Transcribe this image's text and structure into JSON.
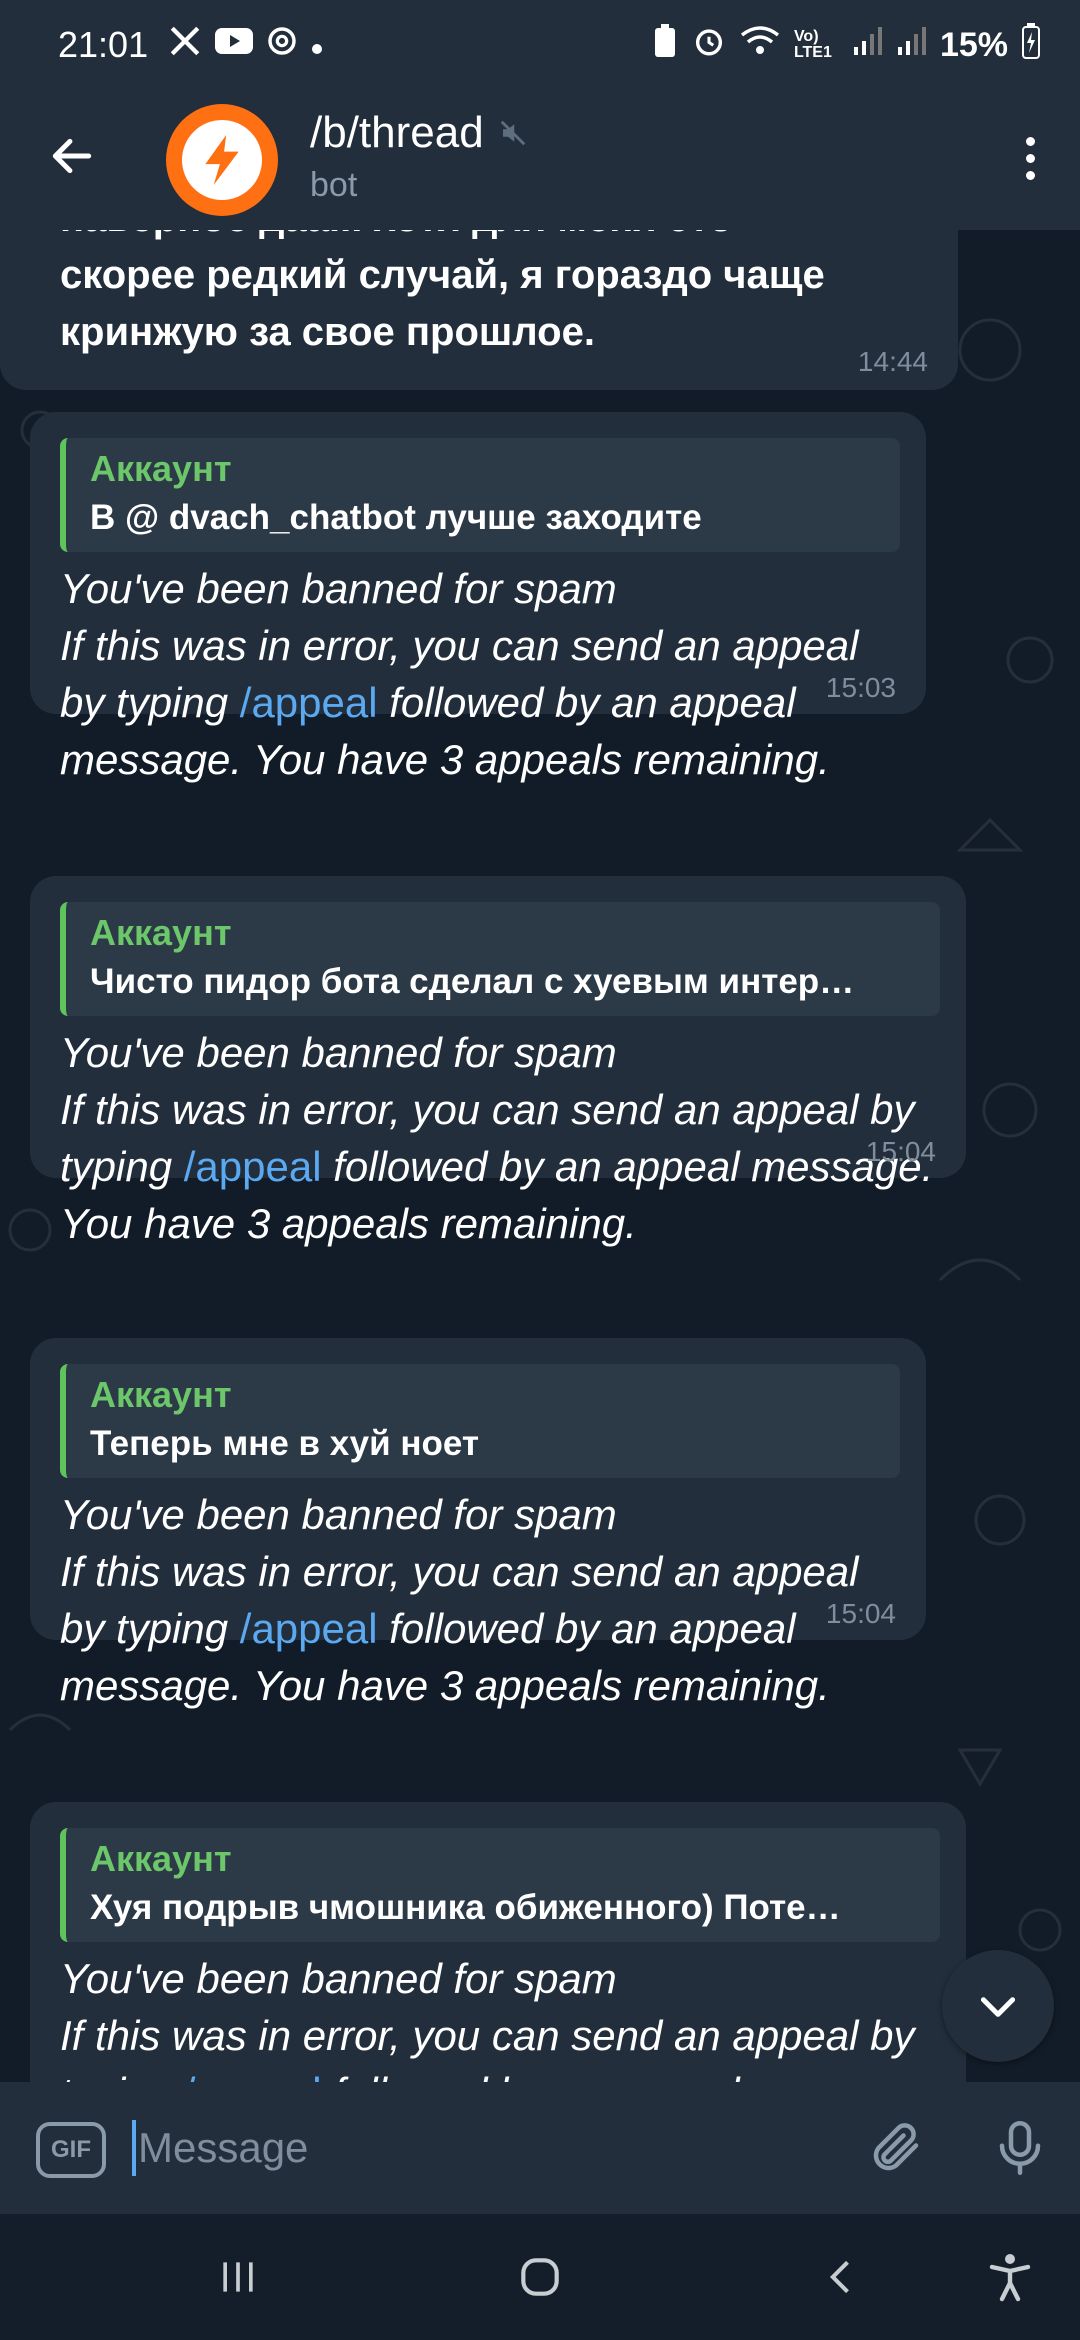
{
  "status_bar": {
    "time": "21:01",
    "left_icons": [
      "x-icon",
      "youtube-icon",
      "threads-icon",
      "dot-icon"
    ],
    "right_icons": [
      "battery-saver-icon",
      "alarm-icon",
      "wifi-icon",
      "volte-icon",
      "signal-icon",
      "signal-icon"
    ],
    "volte_label": "Vo) LTE1",
    "battery": "15%"
  },
  "header": {
    "title": "/b/thread",
    "subtitle": "bot",
    "muted": true,
    "avatar_color": "#ff7012"
  },
  "messages": [
    {
      "type": "text",
      "text": "наверное даа... хотя для меня это скорее редкий случай, я гораздо чаще кринжую за свое прошлое.",
      "time": "14:44"
    },
    {
      "type": "ban",
      "reply_author": "Аккаунт",
      "reply_text": "В @ dvach_chatbot лучше заходите",
      "line1": "You've been banned for spam",
      "line2": "If this was in error, you can send an appeal by typing",
      "command": "/appeal",
      "line3": "followed by an appeal message. You have 3 appeals remaining.",
      "time": "15:03"
    },
    {
      "type": "ban",
      "reply_author": "Аккаунт",
      "reply_text": "Чисто пидор бота сделал с хуевым интер…",
      "line1": "You've been banned for spam",
      "line2": "If this was in error, you can send an appeal by typing",
      "command": "/appeal",
      "line3": "followed by an appeal message. You have 3 appeals remaining.",
      "time": "15:04"
    },
    {
      "type": "ban",
      "reply_author": "Аккаунт",
      "reply_text": "Теперь мне в хуй ноет",
      "line1": "You've been banned for spam",
      "line2": "If this was in error, you can send an appeal by typing",
      "command": "/appeal",
      "line3": "followed by an appeal message. You have 3 appeals remaining.",
      "time": "15:04"
    },
    {
      "type": "ban",
      "reply_author": "Аккаунт",
      "reply_text": "Хуя подрыв чмошника обиженного) Поте…",
      "line1": "You've been banned for spam",
      "line2": "If this was in error, you can send an appeal by typing",
      "command": "/appeal",
      "line3": "followed by an appeal message.",
      "time": ""
    }
  ],
  "input": {
    "gif_label": "GIF",
    "placeholder": "Message"
  },
  "colors": {
    "bubble": "#222e3b",
    "reply_bar": "#5fc45b",
    "command_link": "#5ba9f0"
  }
}
